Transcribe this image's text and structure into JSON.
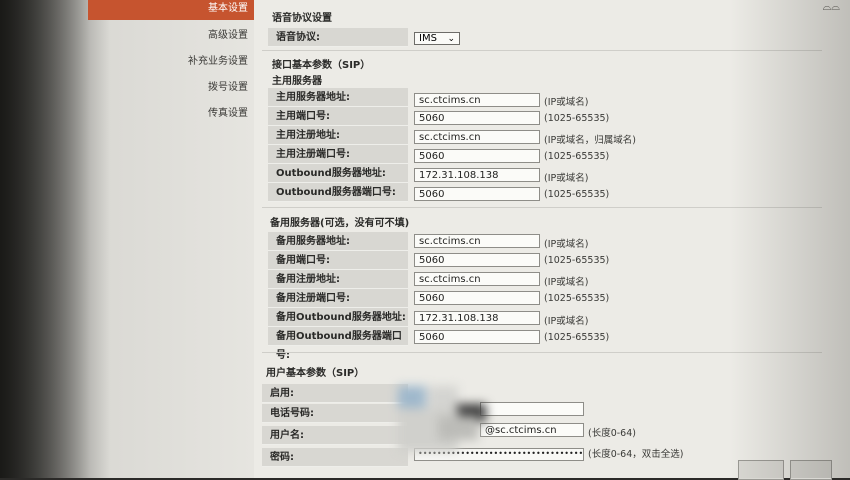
{
  "nav": {
    "items": [
      "基本设置",
      "高级设置",
      "补充业务设置",
      "拨号设置",
      "传真设置"
    ]
  },
  "voice": {
    "section_title": "语音协议设置",
    "label": "语音协议:",
    "value": "IMS"
  },
  "interface": {
    "title": "接口基本参数（SIP）",
    "primary_title": "主用服务器",
    "primary_rows": [
      {
        "label": "主用服务器地址:",
        "value": "sc.ctcims.cn",
        "hint": "(IP或域名)"
      },
      {
        "label": "主用端口号:",
        "value": "5060",
        "hint": "(1025-65535)"
      },
      {
        "label": "主用注册地址:",
        "value": "sc.ctcims.cn",
        "hint": "(IP或域名，归属域名)"
      },
      {
        "label": "主用注册端口号:",
        "value": "5060",
        "hint": "(1025-65535)"
      },
      {
        "label": "Outbound服务器地址:",
        "value": "172.31.108.138",
        "hint": "(IP或域名)"
      },
      {
        "label": "Outbound服务器端口号:",
        "value": "5060",
        "hint": "(1025-65535)"
      }
    ],
    "backup_title": "备用服务器(可选，没有可不填)",
    "backup_rows": [
      {
        "label": "备用服务器地址:",
        "value": "sc.ctcims.cn",
        "hint": "(IP或域名)"
      },
      {
        "label": "备用端口号:",
        "value": "5060",
        "hint": "(1025-65535)"
      },
      {
        "label": "备用注册地址:",
        "value": "sc.ctcims.cn",
        "hint": "(IP或域名)"
      },
      {
        "label": "备用注册端口号:",
        "value": "5060",
        "hint": "(1025-65535)"
      },
      {
        "label": "备用Outbound服务器地址:",
        "value": "172.31.108.138",
        "hint": "(IP或域名)"
      },
      {
        "label": "备用Outbound服务器端口号:",
        "value": "5060",
        "hint": "(1025-65535)"
      }
    ]
  },
  "user": {
    "title": "用户基本参数（SIP）",
    "enable_label": "启用:",
    "phone_label": "电话号码:",
    "username_label": "用户名:",
    "username_value": "@sc.ctcims.cn",
    "username_hint": "(长度0-64)",
    "password_label": "密码:",
    "password_value": "••••••••••••••••••••••••••••••••••••••",
    "password_hint": "(长度0-64，双击全选)"
  },
  "colors": {
    "active_nav": "#c6542f",
    "label_bg": "#d8d7d2",
    "panel_bg": "#ecebe6"
  }
}
